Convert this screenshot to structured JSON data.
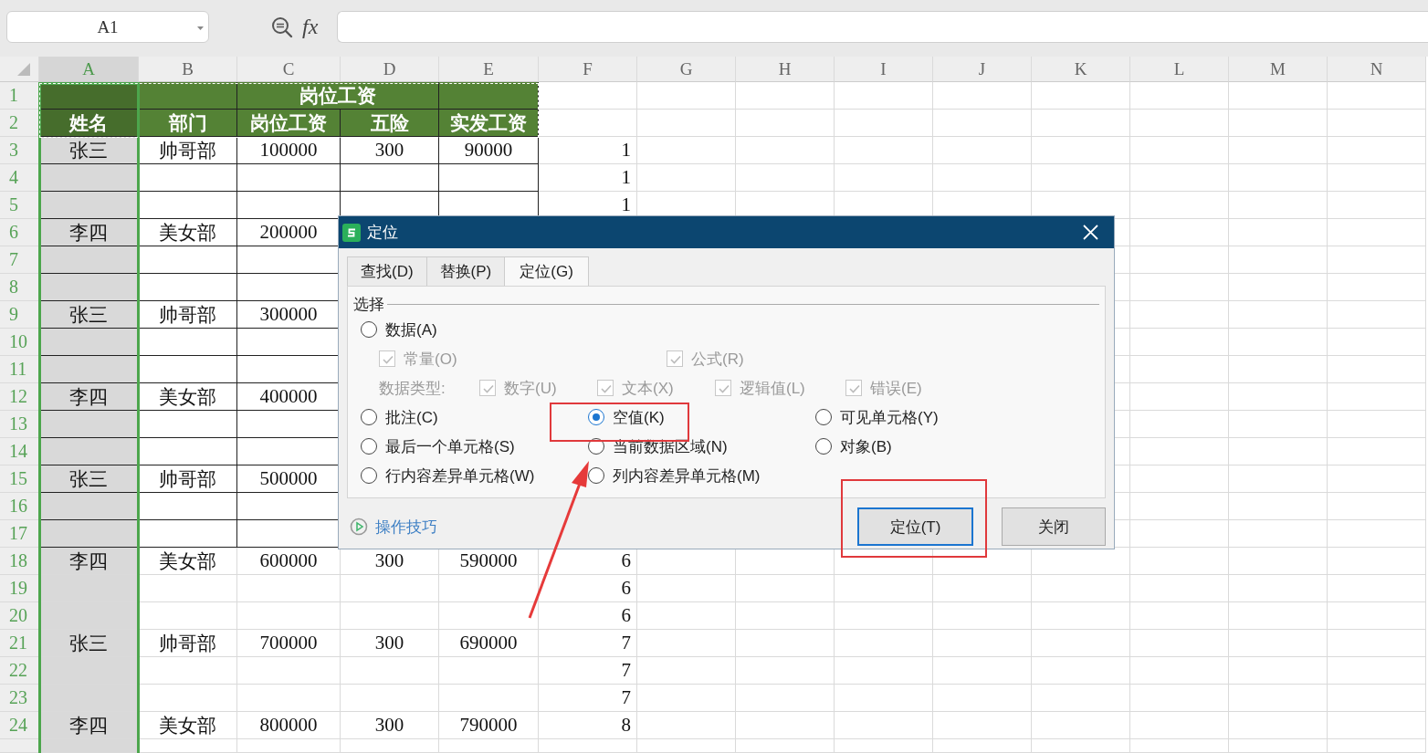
{
  "name_box": {
    "value": "A1"
  },
  "formula_bar": {
    "label": "fx"
  },
  "columns": [
    {
      "label": "A",
      "selected": true
    },
    {
      "label": "B",
      "selected": false
    },
    {
      "label": "C",
      "selected": false
    },
    {
      "label": "D",
      "selected": false
    },
    {
      "label": "E",
      "selected": false
    },
    {
      "label": "F",
      "selected": false
    },
    {
      "label": "G",
      "selected": false
    },
    {
      "label": "H",
      "selected": false
    },
    {
      "label": "I",
      "selected": false
    },
    {
      "label": "J",
      "selected": false
    },
    {
      "label": "K",
      "selected": false
    },
    {
      "label": "L",
      "selected": false
    },
    {
      "label": "M",
      "selected": false
    },
    {
      "label": "N",
      "selected": false
    }
  ],
  "rows": [
    {
      "number": "1",
      "kind": "group_header",
      "cells": {
        "C": "岗位工资"
      }
    },
    {
      "number": "2",
      "kind": "header",
      "cells": {
        "A": "姓名",
        "B": "部门",
        "C": "岗位工资",
        "D": "五险",
        "E": "实发工资"
      }
    },
    {
      "number": "3",
      "kind": "table",
      "cells": {
        "A": "张三",
        "B": "帅哥部",
        "C": "100000",
        "D": "300",
        "E": "90000",
        "F": "1"
      }
    },
    {
      "number": "4",
      "kind": "table",
      "cells": {
        "F": "1"
      }
    },
    {
      "number": "5",
      "kind": "table",
      "cells": {
        "F": "1"
      }
    },
    {
      "number": "6",
      "kind": "table",
      "cells": {
        "A": "李四",
        "B": "美女部",
        "C": "200000"
      }
    },
    {
      "number": "7",
      "kind": "table",
      "cells": {}
    },
    {
      "number": "8",
      "kind": "table",
      "cells": {}
    },
    {
      "number": "9",
      "kind": "table",
      "cells": {
        "A": "张三",
        "B": "帅哥部",
        "C": "300000"
      }
    },
    {
      "number": "10",
      "kind": "table",
      "cells": {}
    },
    {
      "number": "11",
      "kind": "table",
      "cells": {}
    },
    {
      "number": "12",
      "kind": "table",
      "cells": {
        "A": "李四",
        "B": "美女部",
        "C": "400000"
      }
    },
    {
      "number": "13",
      "kind": "table",
      "cells": {}
    },
    {
      "number": "14",
      "kind": "table",
      "cells": {}
    },
    {
      "number": "15",
      "kind": "table",
      "cells": {
        "A": "张三",
        "B": "帅哥部",
        "C": "500000"
      }
    },
    {
      "number": "16",
      "kind": "table",
      "cells": {}
    },
    {
      "number": "17",
      "kind": "table",
      "cells": {}
    },
    {
      "number": "18",
      "kind": "plain",
      "cells": {
        "A": "李四",
        "B": "美女部",
        "C": "600000",
        "D": "300",
        "E": "590000",
        "F": "6"
      }
    },
    {
      "number": "19",
      "kind": "plain",
      "cells": {
        "F": "6"
      }
    },
    {
      "number": "20",
      "kind": "plain",
      "cells": {
        "F": "6"
      }
    },
    {
      "number": "21",
      "kind": "plain",
      "cells": {
        "A": "张三",
        "B": "帅哥部",
        "C": "700000",
        "D": "300",
        "E": "690000",
        "F": "7"
      }
    },
    {
      "number": "22",
      "kind": "plain",
      "cells": {
        "F": "7"
      }
    },
    {
      "number": "23",
      "kind": "plain",
      "cells": {
        "F": "7"
      }
    },
    {
      "number": "24",
      "kind": "plain",
      "cells": {
        "A": "李四",
        "B": "美女部",
        "C": "800000",
        "D": "300",
        "E": "790000",
        "F": "8"
      }
    }
  ],
  "dialog": {
    "title": "定位",
    "tabs": [
      {
        "label": "查找(D)",
        "selected": false
      },
      {
        "label": "替换(P)",
        "selected": false
      },
      {
        "label": "定位(G)",
        "selected": true
      }
    ],
    "group_label": "选择",
    "option_rows": [
      {
        "kind": "radios",
        "items": [
          {
            "label": "数据(A)",
            "selected": false
          }
        ]
      },
      {
        "kind": "checks",
        "items": [
          {
            "label": "常量(O)",
            "checked": true,
            "disabled": true
          },
          {
            "label": "公式(R)",
            "checked": true,
            "disabled": true
          }
        ]
      },
      {
        "kind": "types",
        "label": "数据类型:",
        "items": [
          {
            "label": "数字(U)",
            "checked": true,
            "disabled": true
          },
          {
            "label": "文本(X)",
            "checked": true,
            "disabled": true
          },
          {
            "label": "逻辑值(L)",
            "checked": true,
            "disabled": true
          },
          {
            "label": "错误(E)",
            "checked": true,
            "disabled": true
          }
        ]
      },
      {
        "kind": "radios",
        "items": [
          {
            "label": "批注(C)",
            "selected": false
          },
          {
            "label": "空值(K)",
            "selected": true
          },
          {
            "label": "可见单元格(Y)",
            "selected": false
          }
        ]
      },
      {
        "kind": "radios",
        "items": [
          {
            "label": "最后一个单元格(S)",
            "selected": false
          },
          {
            "label": "当前数据区域(N)",
            "selected": false
          },
          {
            "label": "对象(B)",
            "selected": false
          }
        ]
      },
      {
        "kind": "radios",
        "items": [
          {
            "label": "行内容差异单元格(W)",
            "selected": false
          },
          {
            "label": "列内容差异单元格(M)",
            "selected": false
          }
        ]
      }
    ],
    "tips_link": "操作技巧",
    "buttons": [
      {
        "label": "定位(T)",
        "default": true
      },
      {
        "label": "关闭",
        "default": false
      }
    ]
  }
}
